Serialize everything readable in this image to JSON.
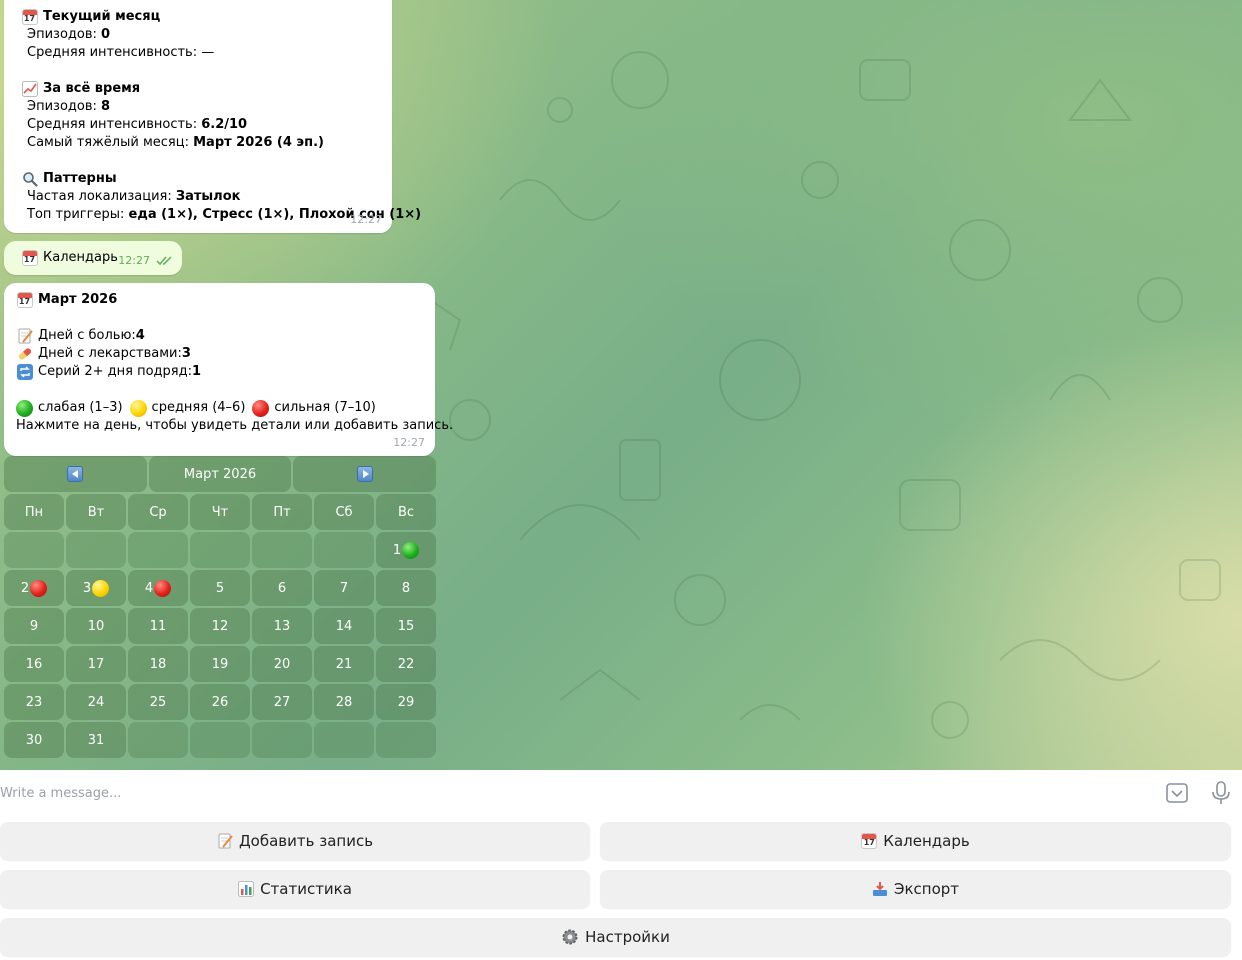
{
  "stats_message": {
    "current_month_title": "Текущий месяц",
    "current_episodes_label": "Эпизодов: ",
    "current_episodes_value": "0",
    "current_intensity_label": "Средняя интенсивность: —",
    "alltime_title": "За всё время",
    "alltime_episodes_label": "Эпизодов: ",
    "alltime_episodes_value": "8",
    "alltime_intensity_label": "Средняя интенсивность: ",
    "alltime_intensity_value": "6.2/10",
    "hardest_month_label": "Самый тяжёлый месяц: ",
    "hardest_month_value": "Март 2026 (4 эп.)",
    "patterns_title": "Паттерны",
    "localization_label": "Частая локализация: ",
    "localization_value": "Затылок",
    "triggers_label": "Топ триггеры: ",
    "triggers_value": "еда (1×), Стресс (1×), Плохой сон (1×)",
    "time": "12:27"
  },
  "outgoing_message": {
    "text": "Календарь",
    "time": "12:27"
  },
  "calendar_message": {
    "title": "Март 2026",
    "pain_days_label": "Дней с болью: ",
    "pain_days_value": "4",
    "meds_days_label": "Дней с лекарствами: ",
    "meds_days_value": "3",
    "series_label": "Серий 2+ дня подряд: ",
    "series_value": "1",
    "legend_weak": "слабая (1–3)",
    "legend_medium": "средняя (4–6)",
    "legend_strong": "сильная (7–10)",
    "hint": "Нажмите на день, чтобы увидеть детали или добавить запись.",
    "time": "12:27"
  },
  "calendar_keyboard": {
    "month_label": "Март 2026",
    "weekdays": [
      "Пн",
      "Вт",
      "Ср",
      "Чт",
      "Пт",
      "Сб",
      "Вс"
    ],
    "weeks": [
      [
        null,
        null,
        null,
        null,
        null,
        null,
        {
          "day": "1",
          "mark": "green"
        }
      ],
      [
        {
          "day": "2",
          "mark": "red"
        },
        {
          "day": "3",
          "mark": "yellow"
        },
        {
          "day": "4",
          "mark": "red"
        },
        {
          "day": "5"
        },
        {
          "day": "6"
        },
        {
          "day": "7"
        },
        {
          "day": "8"
        }
      ],
      [
        {
          "day": "9"
        },
        {
          "day": "10"
        },
        {
          "day": "11"
        },
        {
          "day": "12"
        },
        {
          "day": "13"
        },
        {
          "day": "14"
        },
        {
          "day": "15"
        }
      ],
      [
        {
          "day": "16"
        },
        {
          "day": "17"
        },
        {
          "day": "18"
        },
        {
          "day": "19"
        },
        {
          "day": "20"
        },
        {
          "day": "21"
        },
        {
          "day": "22"
        }
      ],
      [
        {
          "day": "23"
        },
        {
          "day": "24"
        },
        {
          "day": "25"
        },
        {
          "day": "26"
        },
        {
          "day": "27"
        },
        {
          "day": "28"
        },
        {
          "day": "29"
        }
      ],
      [
        {
          "day": "30"
        },
        {
          "day": "31"
        },
        null,
        null,
        null,
        null,
        null
      ]
    ],
    "mark_colors": {
      "green": "#1fae1f",
      "yellow": "#ffd500",
      "red": "#e3221a"
    }
  },
  "input": {
    "placeholder": "Write a message..."
  },
  "reply_keyboard": {
    "add_entry": "Добавить запись",
    "calendar": "Календарь",
    "statistics": "Статистика",
    "export": "Экспорт",
    "settings": "Настройки"
  },
  "icons": {
    "calendar": "calendar-icon",
    "chart_up": "chart-increasing-icon",
    "magnifier": "magnifying-glass-icon",
    "memo": "memo-icon",
    "pill": "pill-icon",
    "repeat": "repeat-icon",
    "bar_chart": "bar-chart-icon",
    "inbox": "inbox-tray-icon",
    "gear": "gear-icon",
    "check": "double-check-icon",
    "keyboard_toggle": "keyboard-toggle-icon",
    "microphone": "microphone-icon"
  }
}
